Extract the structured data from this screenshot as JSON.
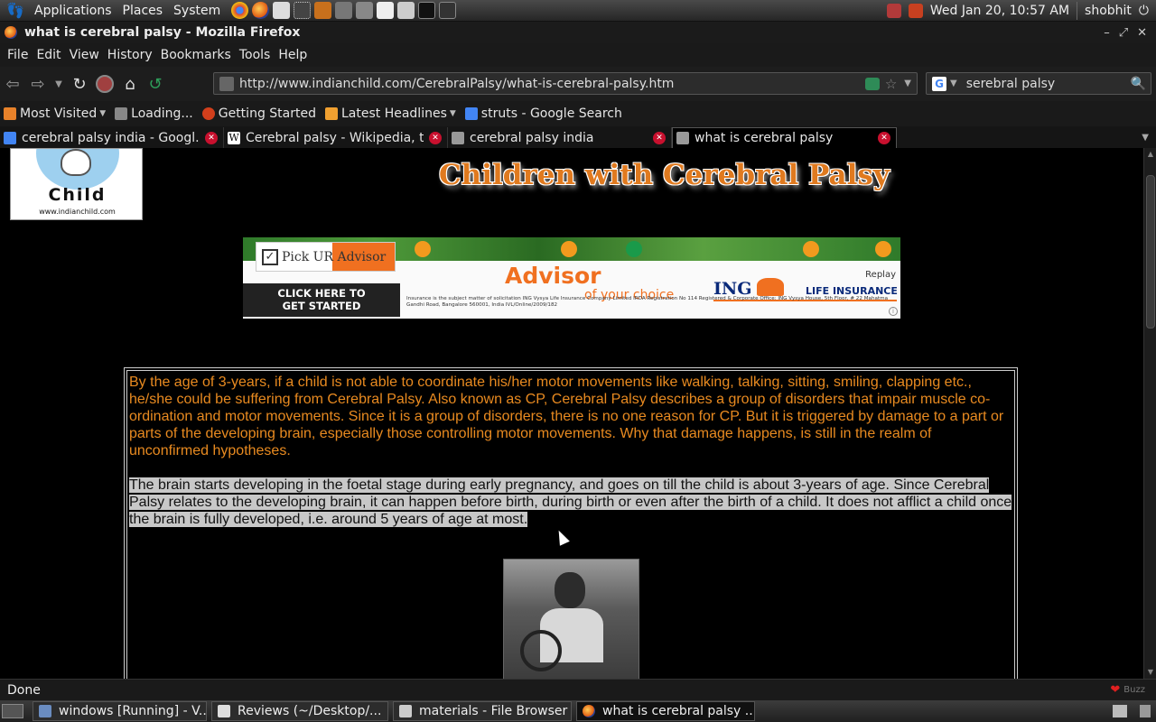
{
  "top_panel": {
    "menus": [
      "Applications",
      "Places",
      "System"
    ],
    "datetime": "Wed Jan 20, 10:57 AM",
    "user": "shobhit"
  },
  "window": {
    "title": "what is cerebral palsy - Mozilla Firefox"
  },
  "menubar": [
    "File",
    "Edit",
    "View",
    "History",
    "Bookmarks",
    "Tools",
    "Help"
  ],
  "navbar": {
    "url": "http://www.indianchild.com/CerebralPalsy/what-is-cerebral-palsy.htm",
    "search_query": "serebral palsy"
  },
  "bookmarks": [
    {
      "label": "Most Visited",
      "has_menu": true,
      "color": "#e8822a"
    },
    {
      "label": "Loading...",
      "has_menu": false,
      "color": "#888888"
    },
    {
      "label": "Getting Started",
      "has_menu": false,
      "color": "#d23f1c"
    },
    {
      "label": "Latest Headlines",
      "has_menu": true,
      "color": "#f0a030"
    },
    {
      "label": "struts - Google Search",
      "has_menu": false,
      "color": "#4285f4"
    }
  ],
  "tabs": [
    {
      "label": "cerebral palsy india - Googl...",
      "icon_color": "#4285f4",
      "active": false
    },
    {
      "label": "Cerebral palsy - Wikipedia, t...",
      "icon_color": "#ffffff",
      "active": false
    },
    {
      "label": "cerebral palsy india",
      "icon_color": "#999999",
      "active": false
    },
    {
      "label": "what is cerebral palsy",
      "icon_color": "#999999",
      "active": true
    }
  ],
  "page": {
    "logo_word": "Child",
    "logo_url": "www.indianchild.com",
    "heading": "Children with Cerebral Palsy",
    "ad": {
      "pick": "Pick UR Advisor",
      "cta_line1": "CLICK HERE TO",
      "cta_line2": "GET STARTED",
      "advisor": "Advisor",
      "of_your_choice": "of your choice",
      "replay": "Replay",
      "brand": "ING",
      "life_insurance": "LIFE INSURANCE",
      "fine_print": "Insurance is the subject matter of solicitation ING Vysya Life Insurance Company Limited IRDA Registration No 114 Registered & Corporate Office: ING Vysya House, 5th Floor, # 22 Mahatma Gandhi Road, Bangalore 560001, India IVL/Online/2009/182"
    },
    "paragraph1": "By the age of 3-years, if a child is not able to coordinate his/her motor movements like walking, talking, sitting, smiling, clapping etc., he/she could be suffering from Cerebral Palsy. Also known as CP, Cerebral Palsy describes a group of disorders that impair muscle co-ordination and motor movements. Since it is a group of disorders, there is no one reason for CP. But it is triggered by damage to a part or parts of the developing brain, especially those controlling motor movements. Why that damage happens, is still in the realm of unconfirmed hypotheses.",
    "paragraph2": "The brain starts developing in the foetal stage during early pregnancy, and goes on till the child is about 3-years of age. Since Cerebral Palsy relates to the developing brain, it can happen before birth, during birth or even after the birth of a child. It does not afflict a child once the brain is fully developed, i.e. around 5 years of age at most."
  },
  "statusbar": {
    "text": "Done",
    "buzz": "Buzz"
  },
  "taskbar": [
    {
      "label": "windows [Running] - V...",
      "icon_color": "#6a8cc0",
      "active": false
    },
    {
      "label": "Reviews (~/Desktop/...",
      "icon_color": "#dddddd",
      "active": false
    },
    {
      "label": "materials - File Browser",
      "icon_color": "#cccccc",
      "active": false
    },
    {
      "label": "what is cerebral palsy ...",
      "icon_color": "#e0601a",
      "active": true
    }
  ]
}
